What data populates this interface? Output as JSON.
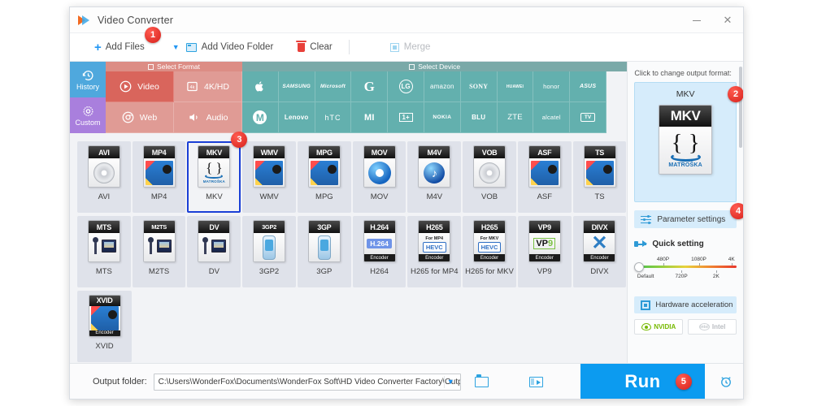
{
  "window": {
    "title": "Video Converter",
    "minimize_label": "—",
    "close_label": "✕"
  },
  "toolbar": {
    "add_files": "Add Files",
    "add_video_folder": "Add Video Folder",
    "clear": "Clear",
    "merge": "Merge"
  },
  "sidebar": {
    "history": "History",
    "custom": "Custom"
  },
  "bands": {
    "select_format": "Select Format",
    "select_device": "Select Device"
  },
  "categories": [
    {
      "label": "Video",
      "selected": true
    },
    {
      "label": "4K/HD",
      "selected": false
    },
    {
      "label": "Web",
      "selected": false
    },
    {
      "label": "Audio",
      "selected": false
    }
  ],
  "devices_row1": [
    "Apple",
    "SAMSUNG",
    "Microsoft",
    "G",
    "LG",
    "amazon",
    "SONY",
    "HUAWEI",
    "honor",
    "ASUS"
  ],
  "devices_row2": [
    "Motorola",
    "Lenovo",
    "hTC",
    "MI",
    "1+",
    "NOKIA",
    "BLU",
    "ZTE",
    "alcatel",
    "TV"
  ],
  "formats": [
    [
      {
        "label": "AVI",
        "head": "AVI",
        "art": "disc",
        "foot": ""
      },
      {
        "label": "MP4",
        "head": "MP4",
        "art": "film",
        "foot": ""
      },
      {
        "label": "MKV",
        "head": "MKV",
        "art": "matroska",
        "foot": "",
        "selected": true
      },
      {
        "label": "WMV",
        "head": "WMV",
        "art": "film",
        "foot": ""
      },
      {
        "label": "MPG",
        "head": "MPG",
        "art": "film",
        "foot": ""
      },
      {
        "label": "MOV",
        "head": "MOV",
        "art": "qt",
        "foot": ""
      },
      {
        "label": "M4V",
        "head": "M4V",
        "art": "note",
        "foot": ""
      },
      {
        "label": "VOB",
        "head": "VOB",
        "art": "disc",
        "foot": ""
      },
      {
        "label": "ASF",
        "head": "ASF",
        "art": "film",
        "foot": ""
      },
      {
        "label": "TS",
        "head": "TS",
        "art": "film",
        "foot": ""
      }
    ],
    [
      {
        "label": "MTS",
        "head": "MTS",
        "art": "cam",
        "foot": ""
      },
      {
        "label": "M2TS",
        "head": "M2TS",
        "art": "cam",
        "foot": ""
      },
      {
        "label": "DV",
        "head": "DV",
        "art": "cam",
        "foot": ""
      },
      {
        "label": "3GP2",
        "head": "3GP2",
        "art": "phone",
        "foot": ""
      },
      {
        "label": "3GP",
        "head": "3GP",
        "art": "phone",
        "foot": ""
      },
      {
        "label": "H264",
        "head": "H.264",
        "art": "h264",
        "foot": "Encoder"
      },
      {
        "label": "H265 for MP4",
        "head": "H265",
        "sub": "For MP4",
        "art": "hevc",
        "foot": "Encoder"
      },
      {
        "label": "H265 for MKV",
        "head": "H265",
        "sub": "For MKV",
        "art": "hevc",
        "foot": "Encoder"
      },
      {
        "label": "VP9",
        "head": "VP9",
        "art": "vp9",
        "foot": "Encoder"
      },
      {
        "label": "DIVX",
        "head": "DIVX",
        "art": "divx",
        "foot": "Encoder"
      }
    ],
    [
      {
        "label": "XVID",
        "head": "XVID",
        "art": "film",
        "foot": "Encoder"
      }
    ]
  ],
  "right_panel": {
    "hint": "Click to change output format:",
    "output_format": "MKV",
    "output_icon_head": "MKV",
    "output_icon_caption": "MATROŠKA",
    "parameter_settings": "Parameter settings",
    "quick_setting": "Quick setting",
    "slider_top_labels": [
      "480P",
      "1080P",
      "4K"
    ],
    "slider_bottom_labels": [
      "Default",
      "720P",
      "2K"
    ],
    "hardware_acceleration": "Hardware acceleration",
    "vendor_nvidia": "NVIDIA",
    "vendor_intel": "Intel"
  },
  "bottom": {
    "output_folder_label": "Output folder:",
    "output_folder_path": "C:\\Users\\WonderFox\\Documents\\WonderFox Soft\\HD Video Converter Factory\\OutputVideo\\",
    "run_label": "Run"
  },
  "badges": {
    "one": "1",
    "two": "2",
    "three": "3",
    "four": "4",
    "five": "5"
  },
  "colors": {
    "accent_blue": "#0c9bf0",
    "format_band": "#d9655c",
    "device_band": "#63b0ae",
    "selection_outline": "#1a3fd6",
    "badge_red": "#d6201a"
  }
}
